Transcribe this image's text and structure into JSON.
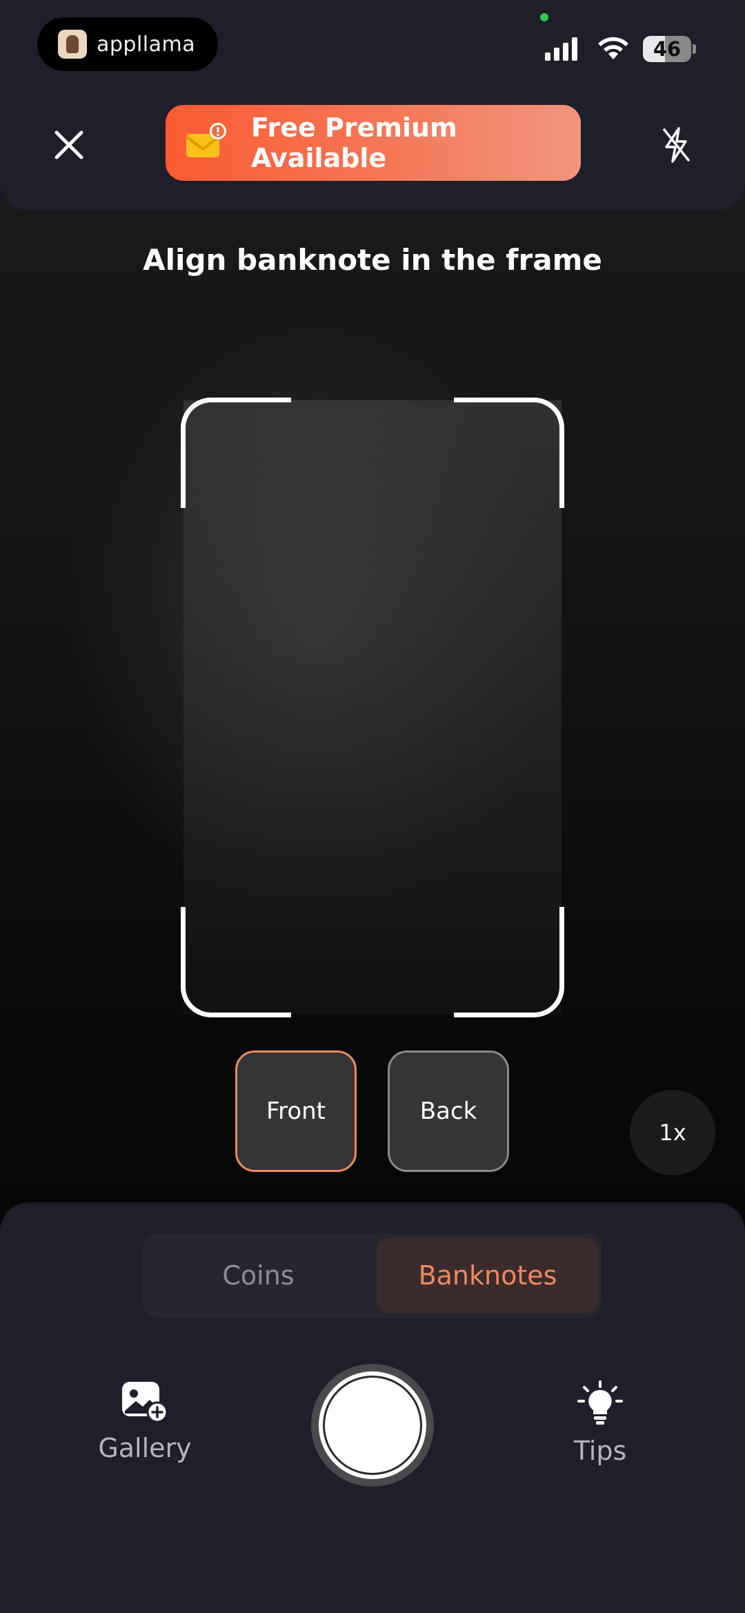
{
  "status_bar": {
    "app_name": "appllama",
    "battery": "46"
  },
  "header": {
    "premium_label": "Free Premium Available"
  },
  "camera": {
    "instruction": "Align banknote in the frame",
    "front_label": "Front",
    "back_label": "Back",
    "zoom_label": "1x"
  },
  "mode_switch": {
    "coins_label": "Coins",
    "banknotes_label": "Banknotes",
    "selected": "Banknotes"
  },
  "toolbar": {
    "gallery_label": "Gallery",
    "tips_label": "Tips"
  },
  "colors": {
    "accent": "#f0895d",
    "premium_gradient_start": "#fb5a32",
    "panel_bg": "#1e1f2a"
  },
  "icons": {
    "close": "close-icon",
    "premium": "mail-badge-icon",
    "flash": "flash-off-icon",
    "gallery": "gallery-add-icon",
    "tips": "lightbulb-icon"
  }
}
